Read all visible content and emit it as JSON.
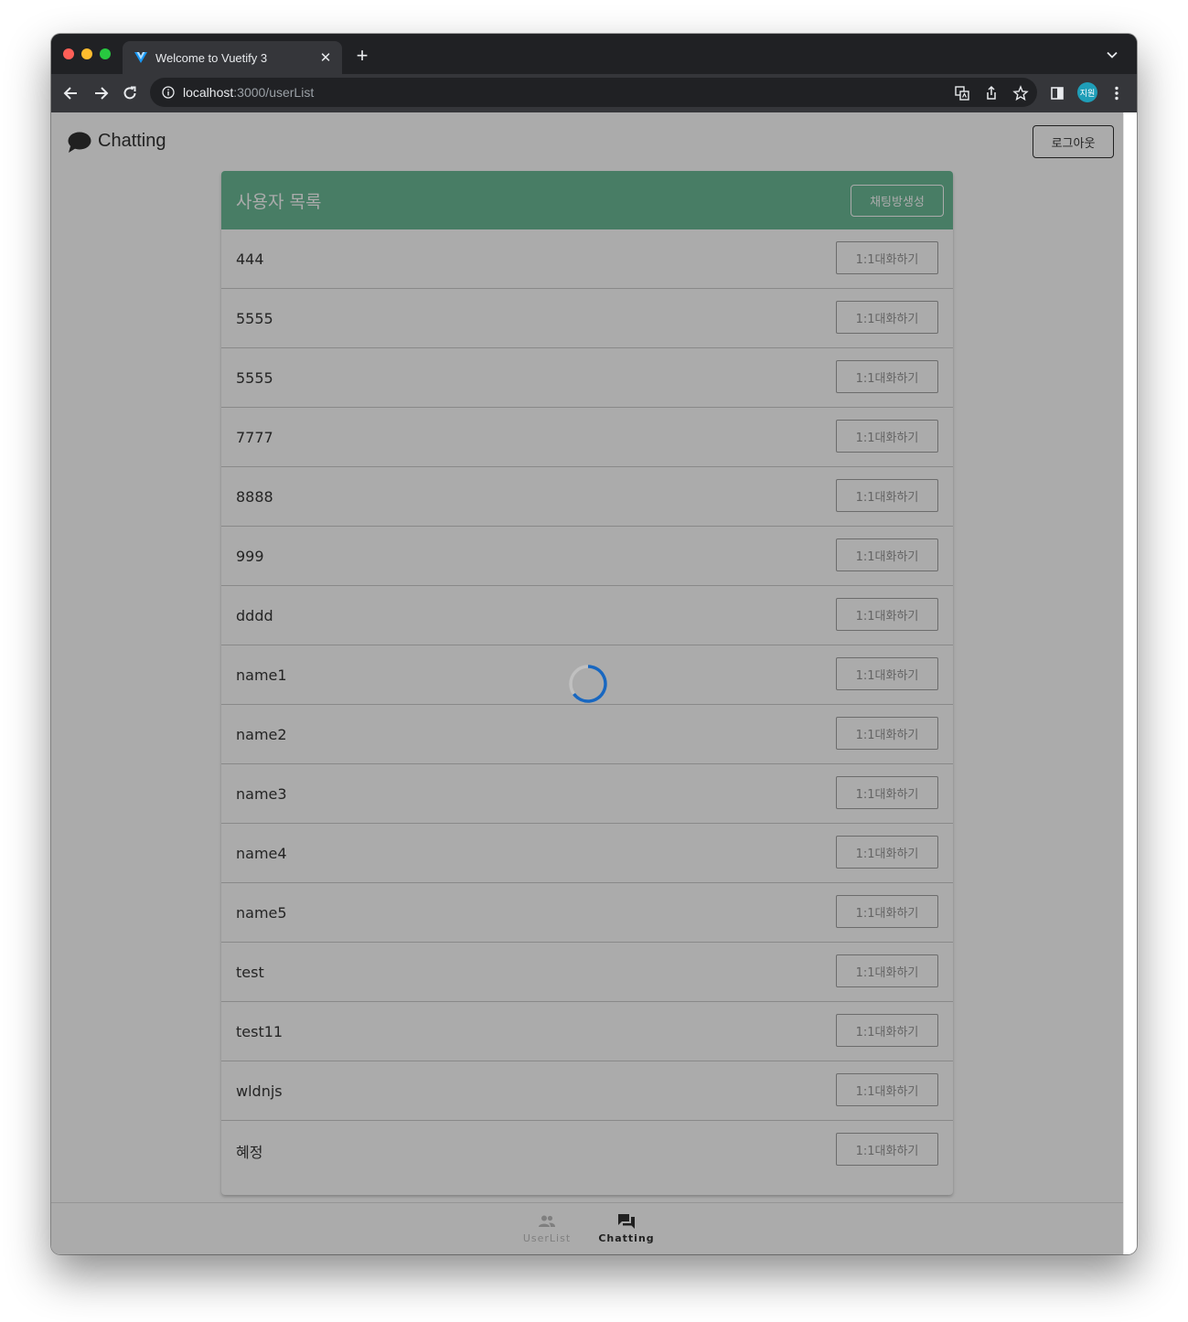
{
  "browser": {
    "tab_title": "Welcome to Vuetify 3",
    "url_host": "localhost",
    "url_path": ":3000/userList",
    "profile_initials": "지원"
  },
  "app": {
    "title": "Chatting",
    "logout_label": "로그아웃"
  },
  "card": {
    "title": "사용자 목록",
    "create_room_label": "채팅방생성",
    "users": [
      {
        "name": "444",
        "action": "1:1대화하기"
      },
      {
        "name": "5555",
        "action": "1:1대화하기"
      },
      {
        "name": "5555",
        "action": "1:1대화하기"
      },
      {
        "name": "7777",
        "action": "1:1대화하기"
      },
      {
        "name": "8888",
        "action": "1:1대화하기"
      },
      {
        "name": "999",
        "action": "1:1대화하기"
      },
      {
        "name": "dddd",
        "action": "1:1대화하기"
      },
      {
        "name": "name1",
        "action": "1:1대화하기"
      },
      {
        "name": "name2",
        "action": "1:1대화하기"
      },
      {
        "name": "name3",
        "action": "1:1대화하기"
      },
      {
        "name": "name4",
        "action": "1:1대화하기"
      },
      {
        "name": "name5",
        "action": "1:1대화하기"
      },
      {
        "name": "test",
        "action": "1:1대화하기"
      },
      {
        "name": "test11",
        "action": "1:1대화하기"
      },
      {
        "name": "wldnjs",
        "action": "1:1대화하기"
      },
      {
        "name": "혜정",
        "action": "1:1대화하기"
      }
    ]
  },
  "bottom_nav": {
    "userlist_label": "UserList",
    "chatting_label": "Chatting"
  },
  "colors": {
    "header_green": "#5fb58f",
    "spinner_blue": "#1867c0"
  }
}
